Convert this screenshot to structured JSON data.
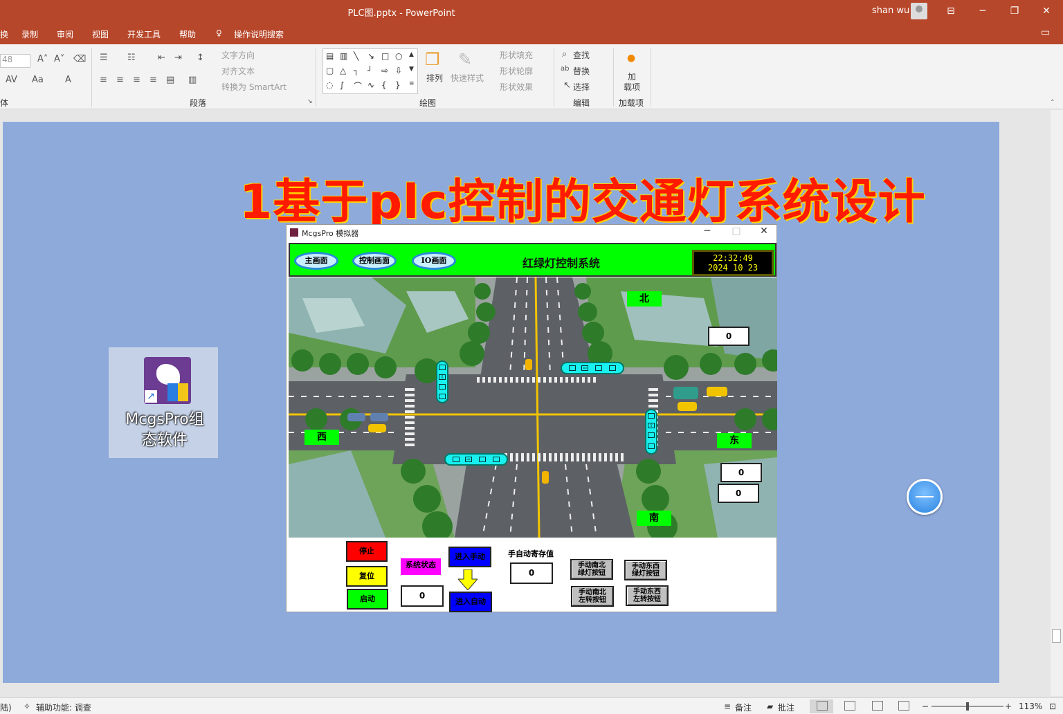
{
  "titlebar": {
    "doc_title": "PLC图.pptx  -  PowerPoint",
    "user_name": "shan wu",
    "ribbon_display_icon": "ribbon-display-icon",
    "minimize": "─",
    "restore": "❐",
    "close": "✕"
  },
  "menu": {
    "tabs": [
      "录制",
      "审阅",
      "视图",
      "开发工具",
      "帮助",
      "操作说明搜索"
    ],
    "partial_left": "换",
    "comment_icon": "comment-icon"
  },
  "ribbon": {
    "font_size": "48",
    "font_group_label": "体",
    "paragraph": {
      "label": "段落",
      "text_direction": "文字方向",
      "align_text": "对齐文本",
      "smartart": "转换为 SmartArt"
    },
    "drawing": {
      "label": "绘图",
      "arrange": "排列",
      "quick_styles": "快速样式",
      "shape_fill": "形状填充",
      "shape_outline": "形状轮廓",
      "shape_effects": "形状效果"
    },
    "editing": {
      "label": "编辑",
      "find": "查找",
      "replace": "替换",
      "select": "选择"
    },
    "addins": {
      "label": "加载项",
      "button": "加\n载项"
    }
  },
  "slide": {
    "title": "1基于plc控制的交通灯系统设计",
    "background": "#8eaadb"
  },
  "shortcut": {
    "label_line1": "McgsPro组",
    "label_line2": "态软件"
  },
  "simulator": {
    "window_title": "McgsPro 模拟器",
    "nav": [
      "主画面",
      "控制画面",
      "IO画面"
    ],
    "header_title": "红绿灯控制系统",
    "clock_time": "22:32:49",
    "clock_date": "2024  10  23",
    "directions": {
      "north": "北",
      "south": "南",
      "east": "东",
      "west": "西"
    },
    "counters": {
      "north": "0",
      "east_1": "0",
      "east_2": "0"
    },
    "controls": {
      "stop": "停止",
      "reset": "复位",
      "start": "启动",
      "system_state_label": "系统状态",
      "system_state_value": "0",
      "enter_manual": "进入手动",
      "enter_auto": "进入自动",
      "manual_auto_register_label": "手自动寄存值",
      "manual_auto_register_value": "0",
      "manual_ns_green_l1": "手动南北",
      "manual_ns_green_l2": "绿灯按钮",
      "manual_ew_green_l1": "手动东西",
      "manual_ew_green_l2": "绿灯按钮",
      "manual_ns_left_l1": "手动南北",
      "manual_ns_left_l2": "左转按钮",
      "manual_ew_left_l1": "手动东西",
      "manual_ew_left_l2": "左转按钮"
    },
    "colors": {
      "header_green": "#00ff00",
      "light_cyan": "#19f0f0",
      "stop_red": "#ff0000",
      "reset_yellow": "#ffff00",
      "start_green": "#00ff00",
      "state_magenta": "#ff00ff",
      "mode_blue": "#0000ff"
    }
  },
  "statusbar": {
    "left_partial": "陆)",
    "accessibility": "辅助功能: 调查",
    "notes": "备注",
    "comments": "批注",
    "zoom": "113%",
    "minus": "−",
    "plus": "+"
  }
}
